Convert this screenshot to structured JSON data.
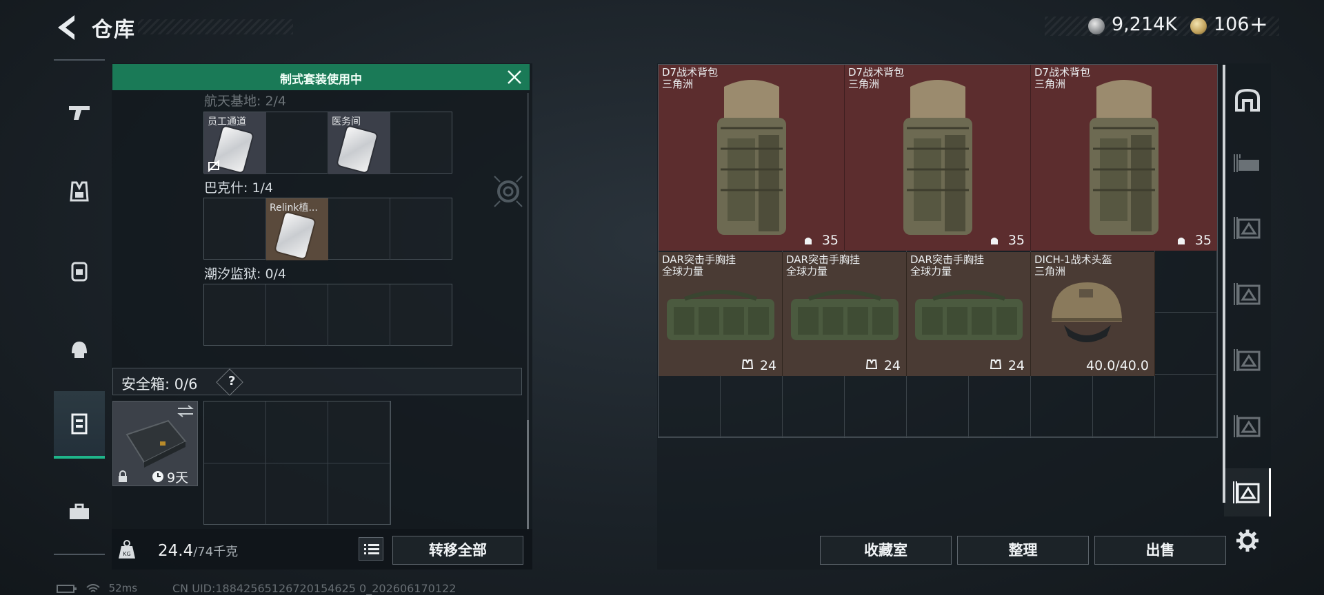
{
  "header": {
    "title": "仓库",
    "silver_value": "9,214K",
    "gold_value": "106",
    "gold_add": "+"
  },
  "left_panel": {
    "banner": "制式套装使用中",
    "sections": [
      {
        "label": "航天基地: 2/4",
        "cards": [
          "员工通道",
          "医务间"
        ]
      },
      {
        "label": "巴克什: 1/4",
        "cards": [
          "Relink植..."
        ]
      },
      {
        "label": "潮汐监狱: 0/4",
        "cards": []
      }
    ],
    "safe_box": {
      "label": "安全箱:  0/6",
      "help": "?",
      "duration": "9天"
    },
    "weight": {
      "current": "24.4",
      "max": "/74千克"
    },
    "transfer_all": "转移全部"
  },
  "storage": {
    "items": [
      {
        "name": "D7战术背包\n三角洲",
        "value": "35"
      },
      {
        "name": "D7战术背包\n三角洲",
        "value": "35"
      },
      {
        "name": "D7战术背包\n三角洲",
        "value": "35"
      },
      {
        "name": "DAR突击手胸挂\n全球力量",
        "value": "24"
      },
      {
        "name": "DAR突击手胸挂\n全球力量",
        "value": "24"
      },
      {
        "name": "DAR突击手胸挂\n全球力量",
        "value": "24"
      },
      {
        "name": "DICH-1战术头盔\n三角洲",
        "value": "40.0/40.0"
      }
    ],
    "collect": "收藏室",
    "sort": "整理",
    "sell": "出售"
  },
  "status": {
    "ping": "52ms",
    "uid": "CN UID:18842565126720154625 0_202606170122"
  },
  "colors": {
    "accent": "#1fb58a",
    "banner": "#1a7a57",
    "item_red": "#5c2d2e",
    "item_brown": "#4a3b34"
  }
}
